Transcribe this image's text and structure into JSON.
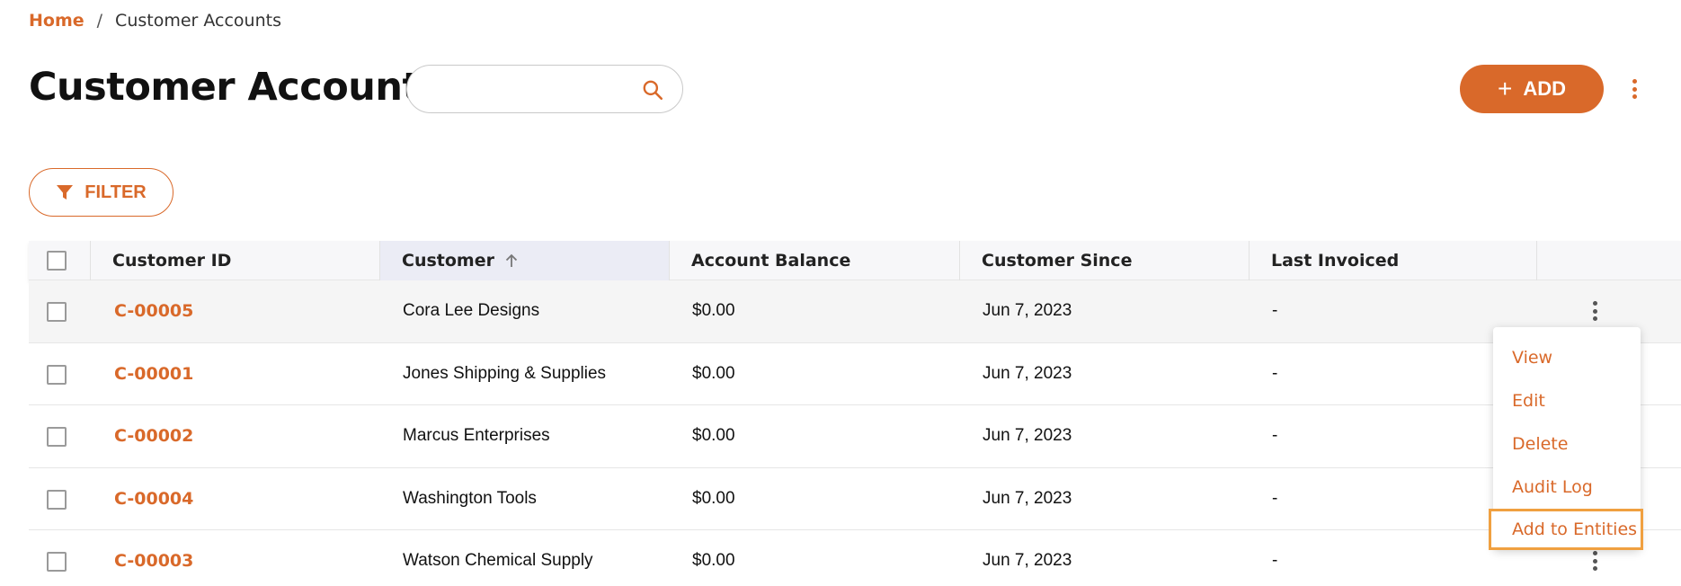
{
  "breadcrumb": {
    "home": "Home",
    "separator": "/",
    "current": "Customer Accounts"
  },
  "page": {
    "title": "Customer Accounts"
  },
  "search": {
    "value": "",
    "placeholder": ""
  },
  "toolbar": {
    "add_label": "ADD",
    "add_icon": "plus",
    "more_icon": "vertical-dots"
  },
  "filter": {
    "label": "FILTER"
  },
  "table": {
    "columns": {
      "customer_id": "Customer ID",
      "customer": "Customer",
      "account_balance": "Account Balance",
      "customer_since": "Customer Since",
      "last_invoiced": "Last Invoiced"
    },
    "sorted_column": "customer",
    "sort_direction": "ascending",
    "rows": [
      {
        "id": "C-00005",
        "customer": "Cora Lee Designs",
        "balance": "$0.00",
        "since": "Jun 7, 2023",
        "last": "-"
      },
      {
        "id": "C-00001",
        "customer": "Jones Shipping & Supplies",
        "balance": "$0.00",
        "since": "Jun 7, 2023",
        "last": "-"
      },
      {
        "id": "C-00002",
        "customer": "Marcus Enterprises",
        "balance": "$0.00",
        "since": "Jun 7, 2023",
        "last": "-"
      },
      {
        "id": "C-00004",
        "customer": "Washington Tools",
        "balance": "$0.00",
        "since": "Jun 7, 2023",
        "last": "-"
      },
      {
        "id": "C-00003",
        "customer": "Watson Chemical Supply",
        "balance": "$0.00",
        "since": "Jun 7, 2023",
        "last": "-"
      }
    ]
  },
  "row_menu": {
    "items": [
      {
        "label": "View"
      },
      {
        "label": "Edit"
      },
      {
        "label": "Delete"
      },
      {
        "label": "Audit Log"
      },
      {
        "label": "Add to Entities",
        "highlighted": true
      }
    ]
  },
  "colors": {
    "accent": "#d9692a",
    "highlight_border": "#f0a040",
    "header_bg": "#f7f7f9",
    "sorted_header_bg": "#ebecf5"
  }
}
